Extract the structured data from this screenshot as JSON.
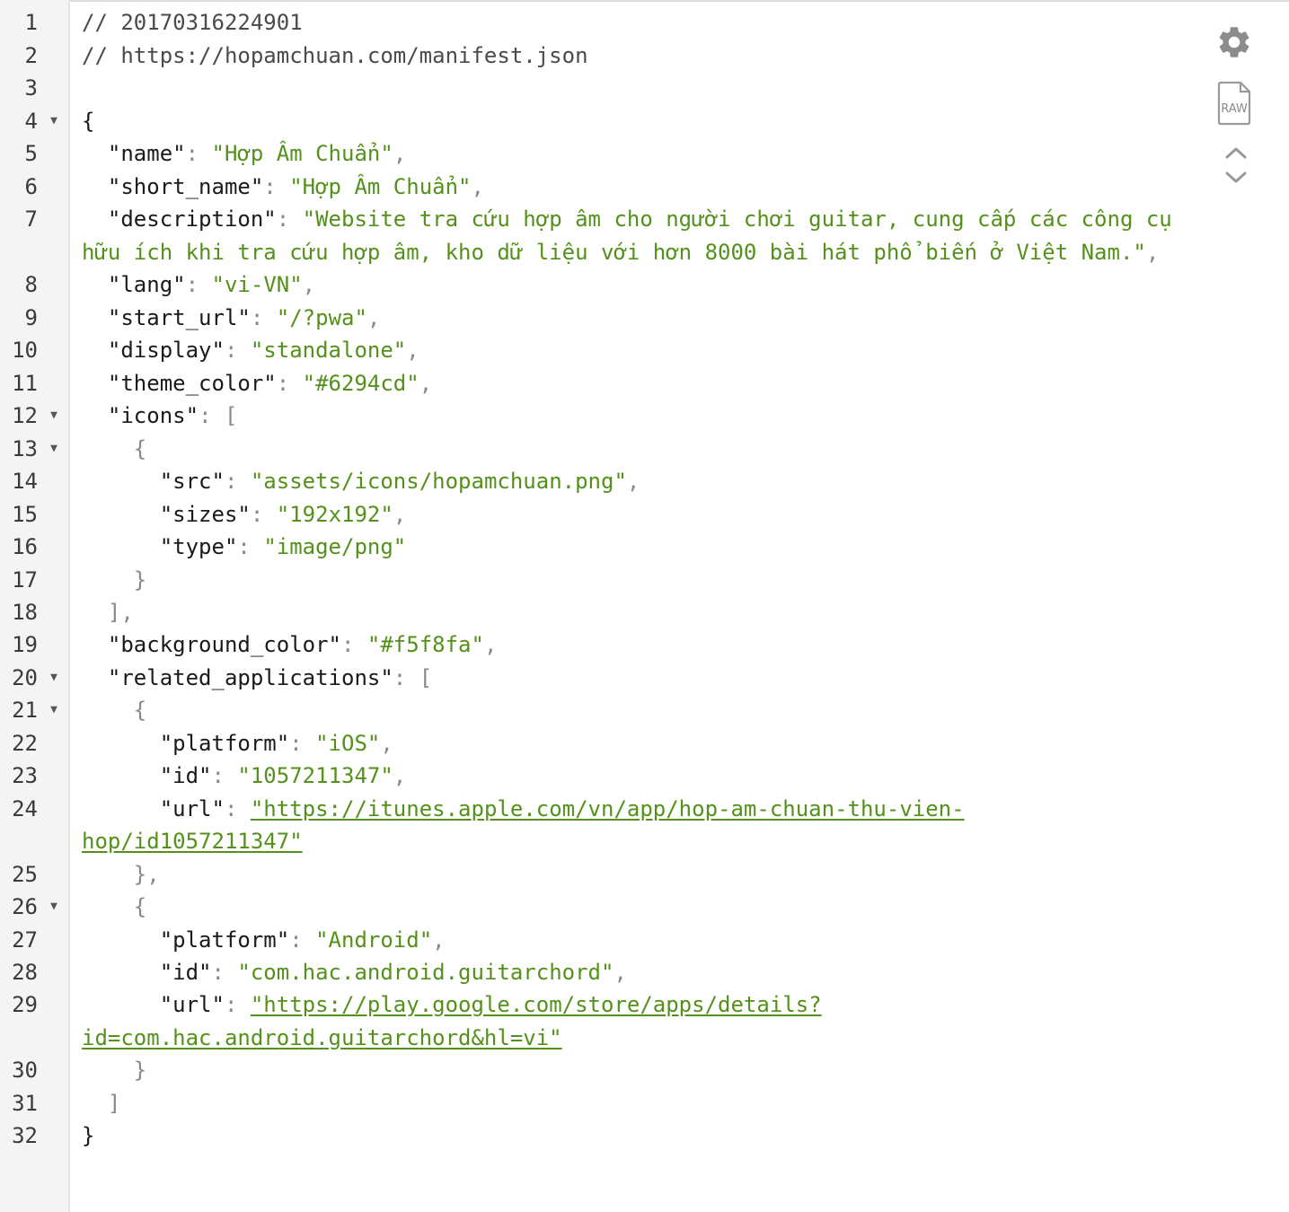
{
  "toolbar": {
    "settings_icon": "gear-icon",
    "raw_icon": "raw-file-icon",
    "raw_label": "RAW",
    "collapse_icon": "chevron-up-icon",
    "expand_icon": "chevron-down-icon"
  },
  "comments": {
    "timestamp": "// 20170316224901",
    "source_url": "// https://hopamchuan.com/manifest.json"
  },
  "json": {
    "open_brace": "{",
    "name_key": "\"name\"",
    "name_value": "\"Hợp Âm Chuẩn\"",
    "short_name_key": "\"short_name\"",
    "short_name_value": "\"Hợp Âm Chuẩn\"",
    "description_key": "\"description\"",
    "description_value_line1": "\"Website tra cứu hợp âm cho người chơi guitar, cung cấp các công cụ",
    "description_value_line2": "hữu ích khi tra cứu hợp âm, kho dữ liệu với hơn 8000 bài hát phổ biến ở Việt Nam.\"",
    "lang_key": "\"lang\"",
    "lang_value": "\"vi-VN\"",
    "start_url_key": "\"start_url\"",
    "start_url_value": "\"/?pwa\"",
    "display_key": "\"display\"",
    "display_value": "\"standalone\"",
    "theme_color_key": "\"theme_color\"",
    "theme_color_value": "\"#6294cd\"",
    "icons_key": "\"icons\"",
    "icon_src_key": "\"src\"",
    "icon_src_value": "\"assets/icons/hopamchuan.png\"",
    "icon_sizes_key": "\"sizes\"",
    "icon_sizes_value": "\"192x192\"",
    "icon_type_key": "\"type\"",
    "icon_type_value": "\"image/png\"",
    "background_color_key": "\"background_color\"",
    "background_color_value": "\"#f5f8fa\"",
    "related_applications_key": "\"related_applications\"",
    "ios_platform_key": "\"platform\"",
    "ios_platform_value": "\"iOS\"",
    "ios_id_key": "\"id\"",
    "ios_id_value": "\"1057211347\"",
    "ios_url_key": "\"url\"",
    "ios_url_value_line1": "\"https://itunes.apple.com/vn/app/hop-am-chuan-thu-vien-",
    "ios_url_value_line2": "hop/id1057211347\"",
    "android_platform_key": "\"platform\"",
    "android_platform_value": "\"Android\"",
    "android_id_key": "\"id\"",
    "android_id_value": "\"com.hac.android.guitarchord\"",
    "android_url_key": "\"url\"",
    "android_url_value_line1": "\"https://play.google.com/store/apps/details?",
    "android_url_value_line2": "id=com.hac.android.guitarchord&hl=vi\"",
    "close_brace": "}"
  },
  "line_numbers": [
    "1",
    "2",
    "3",
    "4",
    "5",
    "6",
    "7",
    "8",
    "9",
    "10",
    "11",
    "12",
    "13",
    "14",
    "15",
    "16",
    "17",
    "18",
    "19",
    "20",
    "21",
    "22",
    "23",
    "24",
    "25",
    "26",
    "27",
    "28",
    "29",
    "30",
    "31",
    "32"
  ],
  "fold_marker": "▼",
  "colors": {
    "string": "#54911a",
    "punctuation": "#888888",
    "gutter_bg": "#f4f4f4",
    "text": "#1a1a1a"
  }
}
